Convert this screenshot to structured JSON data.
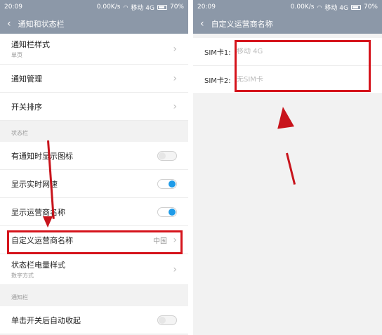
{
  "left": {
    "status": {
      "time": "20:09",
      "speed": "0.00K/s",
      "carrier": "移动 4G",
      "battery": "70%"
    },
    "title": "通知和状态栏",
    "rows_top": [
      {
        "label": "通知栏样式",
        "sub": "单页"
      },
      {
        "label": "通知管理"
      },
      {
        "label": "开关排序"
      }
    ],
    "section_status": "状态栏",
    "toggles": [
      {
        "label": "有通知时显示图标",
        "on": false
      },
      {
        "label": "显示实时网速",
        "on": true
      },
      {
        "label": "显示运营商名称",
        "on": true
      }
    ],
    "custom_carrier": {
      "label": "自定义运营商名称",
      "value": "中国"
    },
    "battery_style": {
      "label": "状态栏电量样式",
      "sub": "数字方式"
    },
    "section_notify": "通知栏",
    "auto_collapse": {
      "label": "单击开关后自动收起",
      "on": false
    }
  },
  "right": {
    "status": {
      "time": "20:09",
      "speed": "0.00K/s",
      "carrier": "移动 4G",
      "battery": "70%"
    },
    "title": "自定义运营商名称",
    "sim1": {
      "label": "SIM卡1:",
      "placeholder": "移动 4G"
    },
    "sim2": {
      "label": "SIM卡2:",
      "placeholder": "无SIM卡"
    }
  },
  "colors": {
    "titlebar": "#8c98a8",
    "highlight": "#d5141c",
    "toggle_on": "#1e9be8"
  }
}
